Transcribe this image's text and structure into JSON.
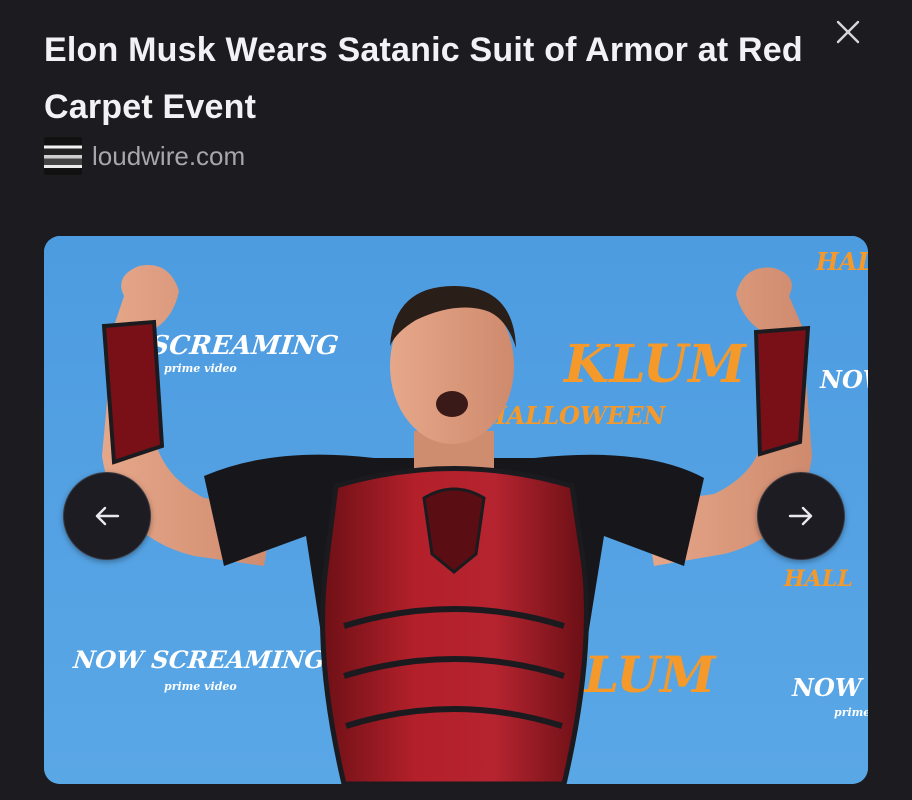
{
  "card": {
    "title": "Elon Musk Wears Satanic Suit of Armor at Red Carpet Event",
    "source": "loudwire.com",
    "close_icon": "close-icon",
    "favicon": "site-favicon"
  },
  "gallery": {
    "photo": {
      "backdrop_texts": [
        "SCREAMING",
        "prime video",
        "KLUM",
        "HALLOWEEN",
        "NOW S",
        "HAL",
        "NOW SCREAMING",
        "prime video",
        "LUM",
        "HALL",
        "NOW SCR",
        "prime vi"
      ]
    },
    "prev_icon": "arrow-left-icon",
    "next_icon": "arrow-right-icon"
  },
  "colors": {
    "background": "#1c1b20",
    "title": "#f2f2f4",
    "source": "#a7a6ad",
    "backdrop": "#4f9fe0",
    "backdrop_text_orange": "#f59a2a",
    "armor_red": "#b3202a",
    "nav_button": "#1d1c22"
  }
}
